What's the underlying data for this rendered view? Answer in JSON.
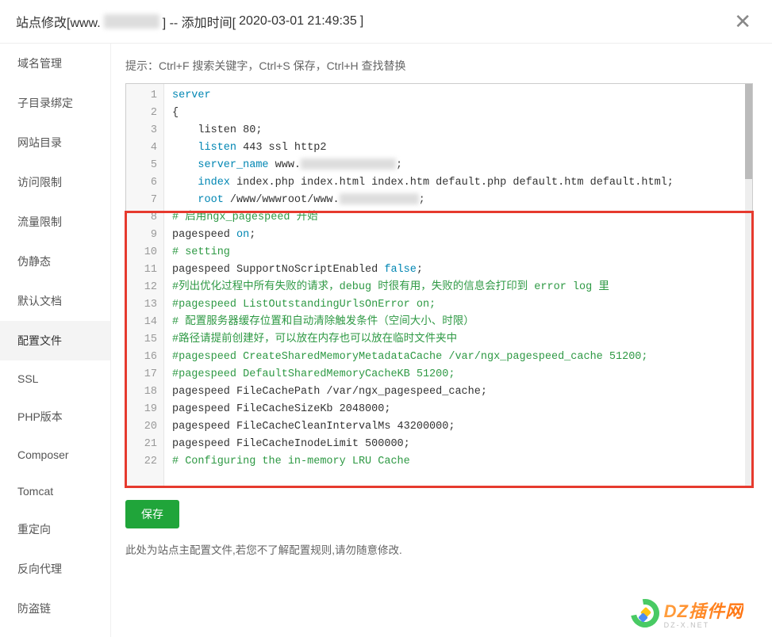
{
  "header": {
    "title_prefix": "站点修改[www.",
    "title_suffix": "] -- 添加时间[",
    "timestamp": "2020-03-01 21:49:35",
    "title_close": "]"
  },
  "sidebar": {
    "items": [
      {
        "label": "域名管理"
      },
      {
        "label": "子目录绑定"
      },
      {
        "label": "网站目录"
      },
      {
        "label": "访问限制"
      },
      {
        "label": "流量限制"
      },
      {
        "label": "伪静态"
      },
      {
        "label": "默认文档"
      },
      {
        "label": "配置文件",
        "active": true
      },
      {
        "label": "SSL"
      },
      {
        "label": "PHP版本"
      },
      {
        "label": "Composer"
      },
      {
        "label": "Tomcat"
      },
      {
        "label": "重定向"
      },
      {
        "label": "反向代理"
      },
      {
        "label": "防盗链"
      }
    ]
  },
  "hint": "提示：Ctrl+F 搜索关键字，Ctrl+S 保存，Ctrl+H 查找替换",
  "code": {
    "lines": [
      {
        "n": 1,
        "tokens": [
          {
            "t": "server",
            "c": "tok-kw"
          }
        ]
      },
      {
        "n": 2,
        "tokens": [
          {
            "t": "{",
            "c": ""
          }
        ]
      },
      {
        "n": 3,
        "tokens": [
          {
            "t": "    listen 80;",
            "c": ""
          }
        ]
      },
      {
        "n": 4,
        "tokens": [
          {
            "t": "    ",
            "c": ""
          },
          {
            "t": "listen",
            "c": "tok-kw"
          },
          {
            "t": " 443 ssl http2",
            "c": ""
          }
        ]
      },
      {
        "n": 5,
        "tokens": [
          {
            "t": "    ",
            "c": ""
          },
          {
            "t": "server_name",
            "c": "tok-kw"
          },
          {
            "t": " www.",
            "c": ""
          },
          {
            "t": "____________",
            "c": "blur",
            "w": 120
          },
          {
            "t": ";",
            "c": ""
          }
        ]
      },
      {
        "n": 6,
        "tokens": [
          {
            "t": "    ",
            "c": ""
          },
          {
            "t": "index",
            "c": "tok-kw"
          },
          {
            "t": " index.php index.html index.htm default.php default.htm default.html;",
            "c": ""
          }
        ]
      },
      {
        "n": 7,
        "tokens": [
          {
            "t": "    ",
            "c": ""
          },
          {
            "t": "root",
            "c": "tok-kw"
          },
          {
            "t": " /www/wwwroot/www.",
            "c": ""
          },
          {
            "t": "_________",
            "c": "blur",
            "w": 100
          },
          {
            "t": ";",
            "c": ""
          }
        ]
      },
      {
        "n": 8,
        "tokens": [
          {
            "t": "# 启用ngx_pagespeed 开始",
            "c": "tok-comment"
          }
        ]
      },
      {
        "n": 9,
        "tokens": [
          {
            "t": "pagespeed ",
            "c": ""
          },
          {
            "t": "on",
            "c": "tok-val"
          },
          {
            "t": ";",
            "c": ""
          }
        ]
      },
      {
        "n": 10,
        "tokens": [
          {
            "t": "# setting",
            "c": "tok-comment"
          }
        ]
      },
      {
        "n": 11,
        "tokens": [
          {
            "t": "pagespeed SupportNoScriptEnabled ",
            "c": ""
          },
          {
            "t": "false",
            "c": "tok-val"
          },
          {
            "t": ";",
            "c": ""
          }
        ]
      },
      {
        "n": 12,
        "tokens": [
          {
            "t": "#列出优化过程中所有失败的请求，debug 时很有用，失败的信息会打印到 error log 里",
            "c": "tok-comment"
          }
        ]
      },
      {
        "n": 13,
        "tokens": [
          {
            "t": "#pagespeed ListOutstandingUrlsOnError on;",
            "c": "tok-comment"
          }
        ]
      },
      {
        "n": 14,
        "tokens": [
          {
            "t": "# 配置服务器缓存位置和自动清除触发条件（空间大小、时限）",
            "c": "tok-comment"
          }
        ]
      },
      {
        "n": 15,
        "tokens": [
          {
            "t": "#路径请提前创建好，可以放在内存也可以放在临时文件夹中",
            "c": "tok-comment"
          }
        ]
      },
      {
        "n": 16,
        "tokens": [
          {
            "t": "#pagespeed CreateSharedMemoryMetadataCache /var/ngx_pagespeed_cache 51200;",
            "c": "tok-comment"
          }
        ]
      },
      {
        "n": 17,
        "tokens": [
          {
            "t": "#pagespeed DefaultSharedMemoryCacheKB 51200;",
            "c": "tok-comment"
          }
        ]
      },
      {
        "n": 18,
        "tokens": [
          {
            "t": "pagespeed FileCachePath /var/ngx_pagespeed_cache;",
            "c": ""
          }
        ]
      },
      {
        "n": 19,
        "tokens": [
          {
            "t": "pagespeed FileCacheSizeKb 2048000;",
            "c": ""
          }
        ]
      },
      {
        "n": 20,
        "tokens": [
          {
            "t": "pagespeed FileCacheCleanIntervalMs 43200000;",
            "c": ""
          }
        ]
      },
      {
        "n": 21,
        "tokens": [
          {
            "t": "pagespeed FileCacheInodeLimit 500000;",
            "c": ""
          }
        ]
      },
      {
        "n": 22,
        "tokens": [
          {
            "t": "# Configuring the in-memory LRU Cache",
            "c": "tok-comment"
          }
        ]
      }
    ]
  },
  "buttons": {
    "save": "保存"
  },
  "footnote": "此处为站点主配置文件,若您不了解配置规则,请勿随意修改.",
  "watermark": {
    "text": "DZ插件网",
    "sub": "DZ-X.NET"
  }
}
